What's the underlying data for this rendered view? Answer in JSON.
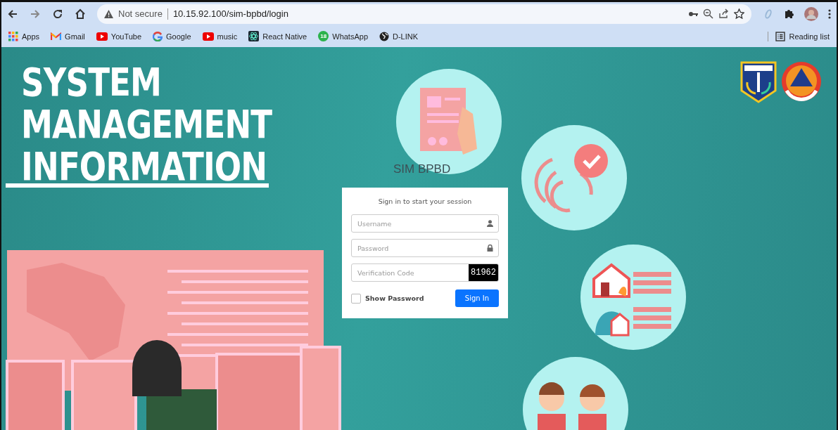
{
  "browser": {
    "security_label": "Not secure",
    "url": "10.15.92.100/sim-bpbd/login"
  },
  "bookmarks": [
    {
      "kind": "apps",
      "label": "Apps"
    },
    {
      "kind": "gmail",
      "label": "Gmail"
    },
    {
      "kind": "youtube",
      "label": "YouTube"
    },
    {
      "kind": "google",
      "label": "Google"
    },
    {
      "kind": "youtube",
      "label": "music"
    },
    {
      "kind": "react",
      "label": "React Native"
    },
    {
      "kind": "whatsapp",
      "label": "WhatsApp",
      "badge": "18"
    },
    {
      "kind": "globe",
      "label": "D-LINK"
    }
  ],
  "reading_list": "Reading list",
  "hero": {
    "title_lines": [
      "SYSTEM",
      "MANAGEMENT",
      "INFORMATION"
    ]
  },
  "app_name": "SIM BPBD",
  "login": {
    "heading": "Sign in to start your session",
    "fields": [
      {
        "kind": "user",
        "placeholder": "Username"
      },
      {
        "kind": "lock",
        "placeholder": "Password"
      },
      {
        "kind": "captcha",
        "placeholder": "Verification Code",
        "captcha": "81962"
      }
    ],
    "show_password": {
      "label": "Show Password",
      "checked": false
    },
    "button": "Sign In"
  }
}
